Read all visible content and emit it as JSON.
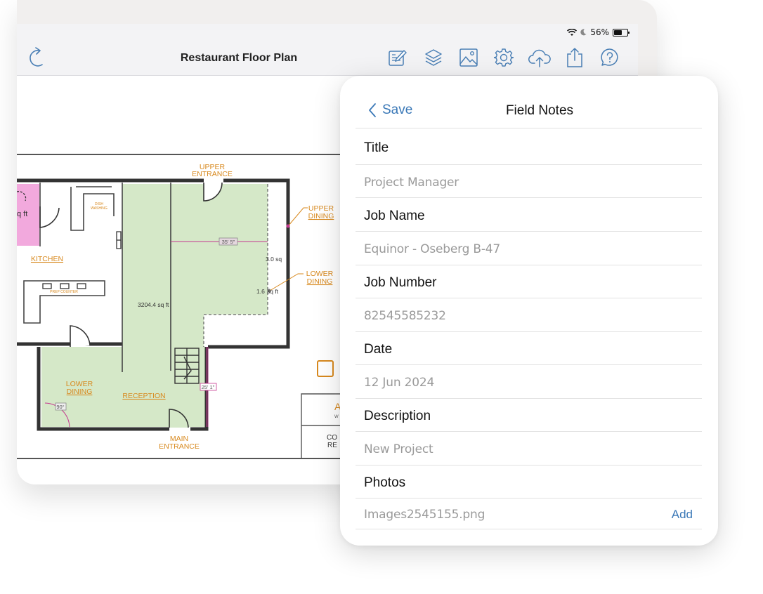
{
  "status": {
    "battery": "56%"
  },
  "document": {
    "title": "Restaurant Floor Plan"
  },
  "toolbar": {
    "icons": [
      "redo-icon",
      "edit-icon",
      "layers-icon",
      "image-icon",
      "settings-icon",
      "cloud-upload-icon",
      "share-icon",
      "help-icon"
    ]
  },
  "floorplan": {
    "labels": {
      "upper_entrance_1": "UPPER",
      "upper_entrance_2": "ENTRANCE",
      "upper_dining_1": "UPPER",
      "upper_dining_2": "DINING",
      "lower_dining_right_1": "LOWER",
      "lower_dining_right_2": "DINING",
      "kitchen": "KITCHEN",
      "dish_washing_1": "DISH",
      "dish_washing_2": "WASHING",
      "prep_counter": "PREP COUNTER",
      "lower_dining_left_1": "LOWER",
      "lower_dining_left_2": "DINING",
      "reception": "RECEPTION",
      "main_entrance_1": "MAIN",
      "main_entrance_2": "ENTRANCE",
      "area_main": "3204.4 sq ft",
      "area_upper": "3.0 sq",
      "area_lower": "1.6",
      "area_lower_unit": "sq ft",
      "area_pink": "q ft",
      "dim_upper": "35' 5\"",
      "dim_vertical": "25' 1\"",
      "angle": "90°",
      "cut_1": "A",
      "cut_2": "W",
      "cut_3": "CO",
      "cut_4": "RE"
    }
  },
  "panel": {
    "back_label": "Save",
    "title": "Field Notes",
    "fields": [
      {
        "label": "Title",
        "value": "Project Manager"
      },
      {
        "label": "Job Name",
        "value": "Equinor - Oseberg B-47"
      },
      {
        "label": "Job Number",
        "value": "82545585232"
      },
      {
        "label": "Date",
        "value": "12 Jun 2024"
      },
      {
        "label": "Description",
        "value": "New Project"
      },
      {
        "label": "Photos",
        "value": "Images2545155.png"
      }
    ],
    "add_label": "Add"
  },
  "colors": {
    "accent": "#3a78b7",
    "room_green": "#d5e8c8",
    "kitchen_pink": "#f0a8dd",
    "label_orange": "#d8891e",
    "dimension_pink": "#c5388f"
  }
}
